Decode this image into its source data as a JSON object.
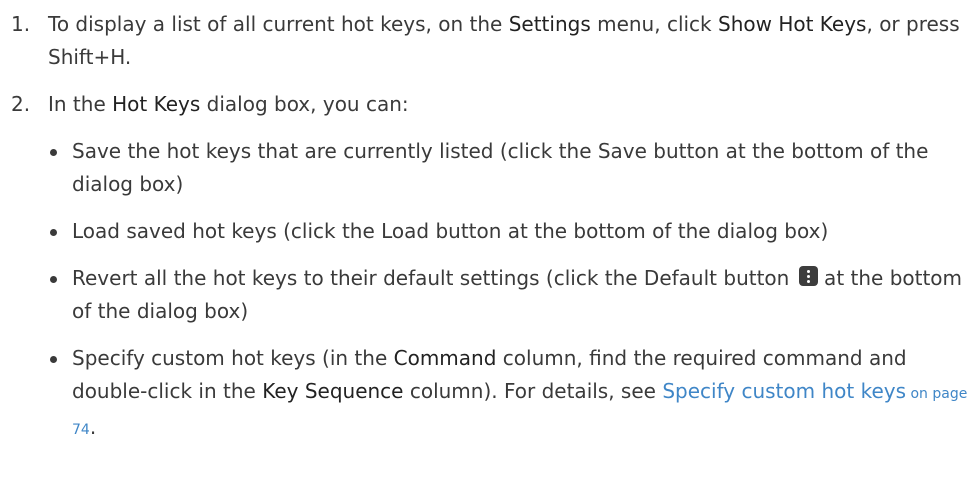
{
  "steps": [
    {
      "num": "1.",
      "p1": "To display a list of all current hot keys, on the ",
      "ui1": "Settings",
      "p2": " menu, click ",
      "ui2": "Show Hot Keys",
      "p3": ", or press Shift+H."
    },
    {
      "num": "2.",
      "p1": "In the ",
      "ui1": "Hot Keys",
      "p2": " dialog box, you can:"
    }
  ],
  "bullets": {
    "save": "Save the hot keys that are currently listed (click the Save button at the bottom of the dialog box)",
    "load": "Load saved hot keys (click the Load button at the bottom of the dialog box)",
    "revert_p1": "Revert all the hot keys to their default settings (click the Default button ",
    "revert_p2": " at the bottom of the dialog box)",
    "custom": {
      "p1": "Specify custom hot keys (in the ",
      "ui1": "Command",
      "p2": " column, find the required command and double-click in the ",
      "ui2": "Key Sequence",
      "p3": " column). For details, see ",
      "link": "Specify custom hot keys",
      "page_ref": " on page 74",
      "end": "."
    }
  },
  "icons": {
    "default_button_icon": "more-vertical-icon"
  }
}
